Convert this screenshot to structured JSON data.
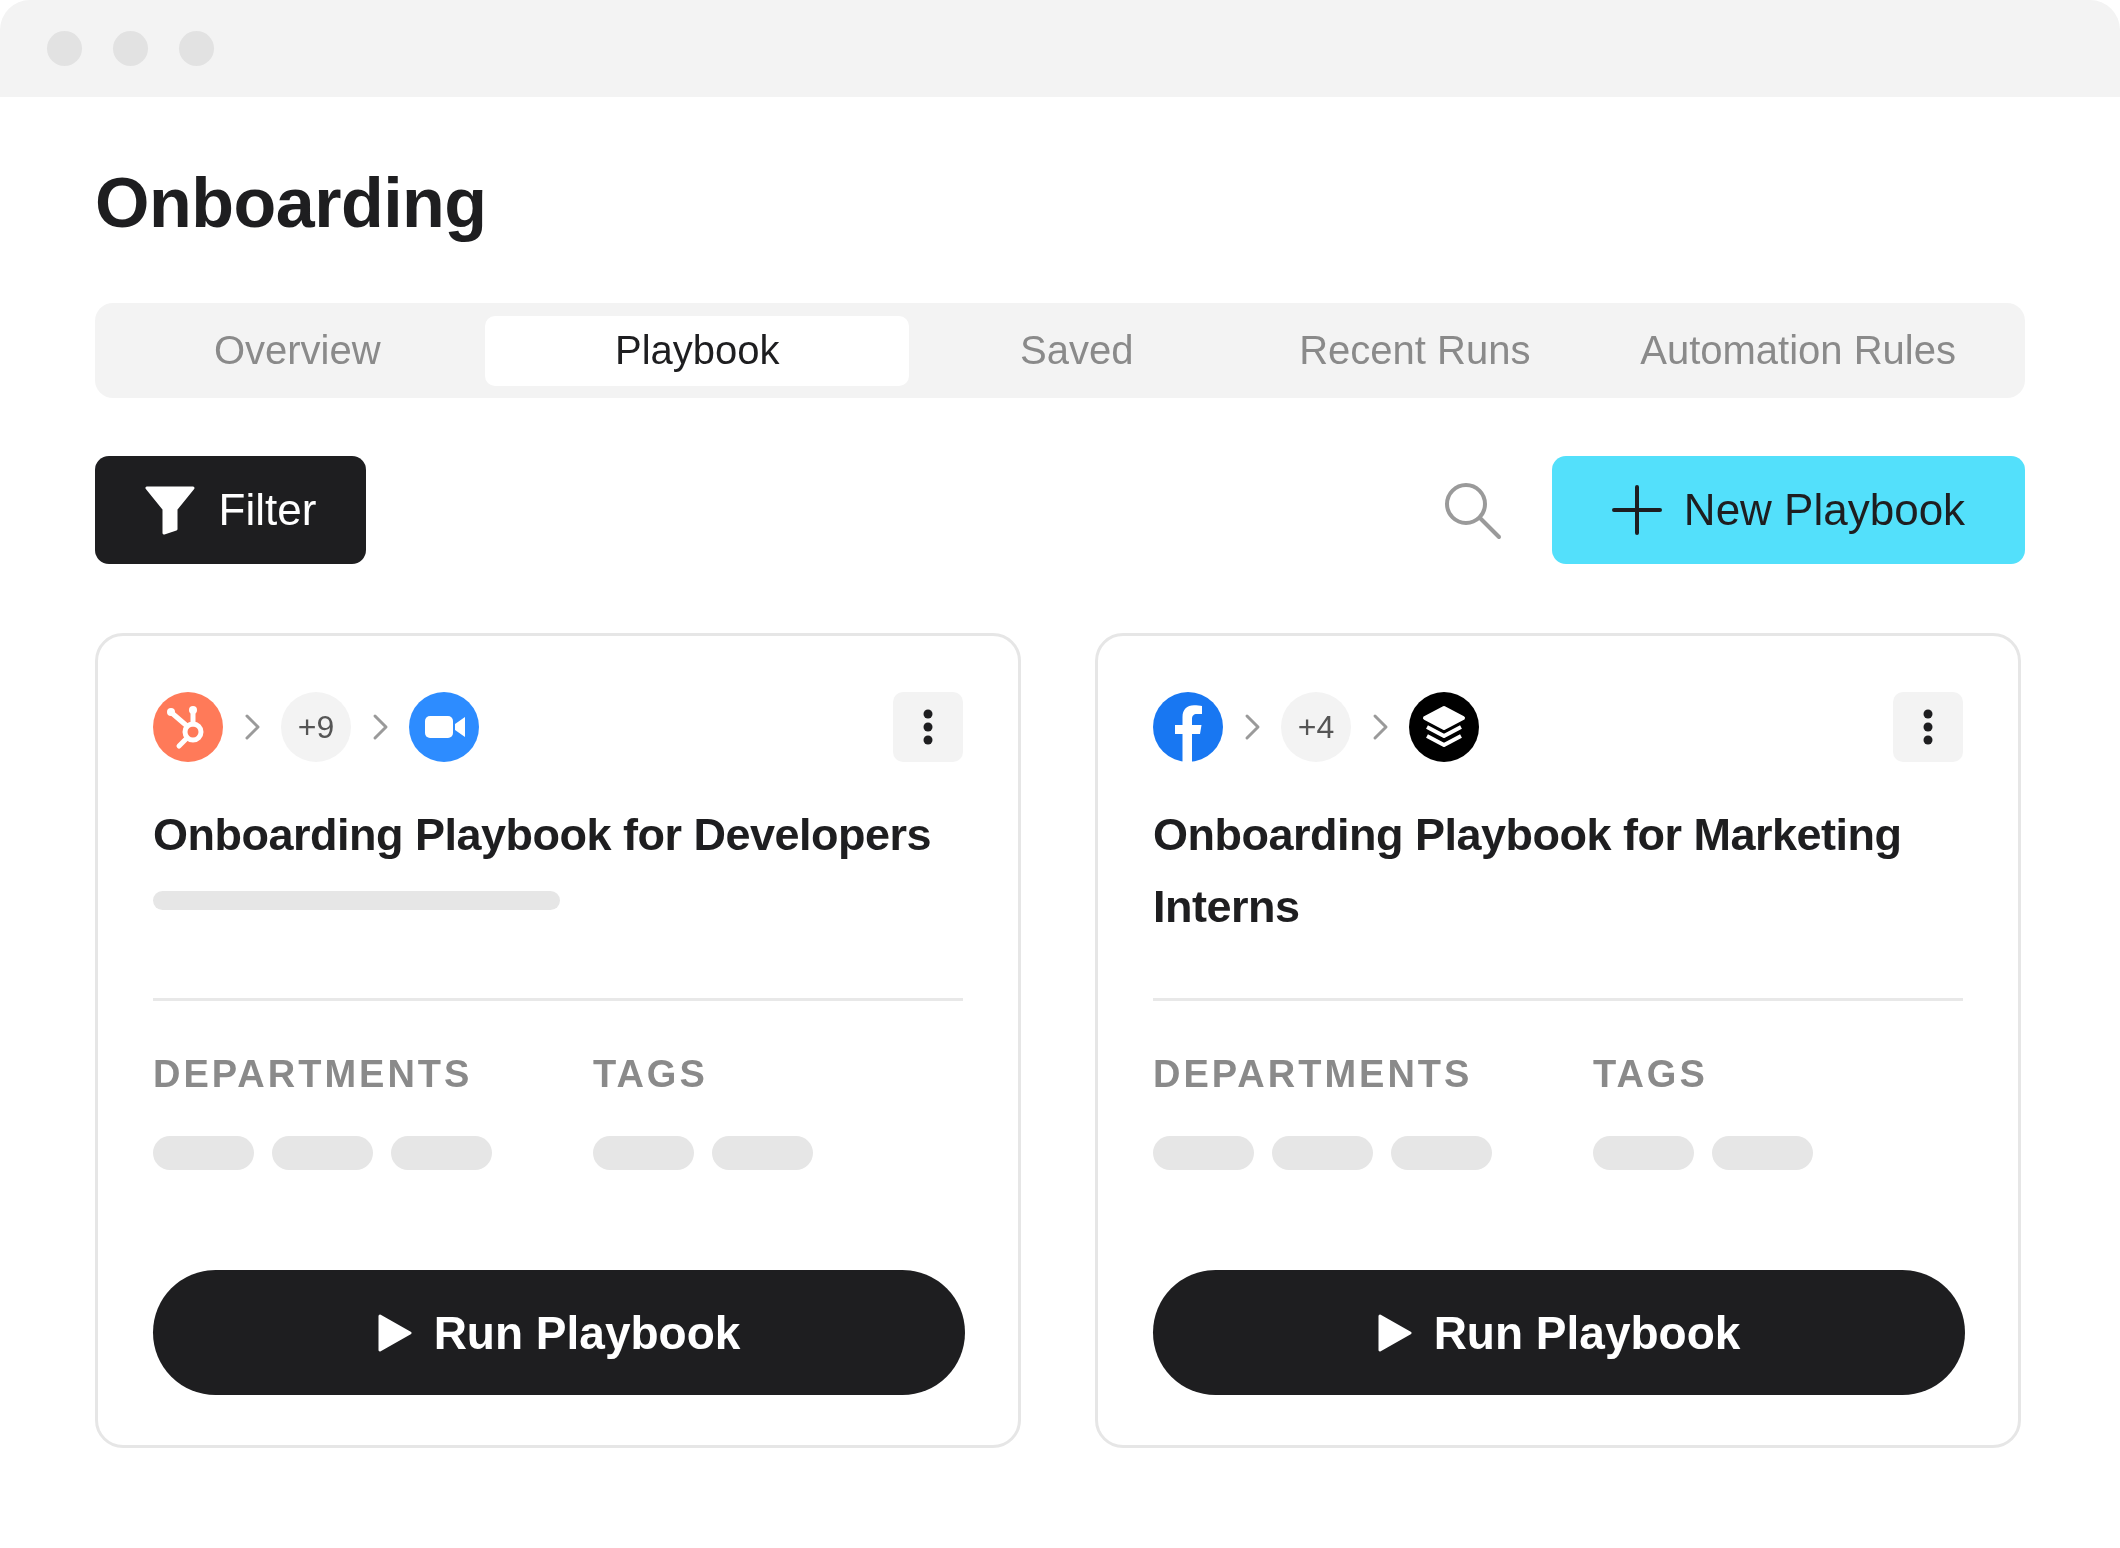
{
  "page": {
    "title": "Onboarding"
  },
  "tabs": [
    {
      "label": "Overview",
      "selected": false
    },
    {
      "label": "Playbook",
      "selected": true
    },
    {
      "label": "Saved",
      "selected": false
    },
    {
      "label": "Recent Runs",
      "selected": false
    },
    {
      "label": "Automation Rules",
      "selected": false
    }
  ],
  "toolbar": {
    "filter_label": "Filter",
    "new_label": "New Playbook"
  },
  "cards": [
    {
      "apps": [
        {
          "kind": "sprocket"
        },
        {
          "kind": "count",
          "label": "+9"
        },
        {
          "kind": "video"
        }
      ],
      "title": "Onboarding Playbook for Developers",
      "loading_line": true,
      "departments_label": "DEPARTMENTS",
      "tags_label": "TAGS",
      "run_label": "Run Playbook"
    },
    {
      "apps": [
        {
          "kind": "letter-f"
        },
        {
          "kind": "count",
          "label": "+4"
        },
        {
          "kind": "layers"
        }
      ],
      "title": "Onboarding Playbook for Marketing Interns",
      "loading_line": false,
      "departments_label": "DEPARTMENTS",
      "tags_label": "TAGS",
      "run_label": "Run Playbook"
    }
  ]
}
